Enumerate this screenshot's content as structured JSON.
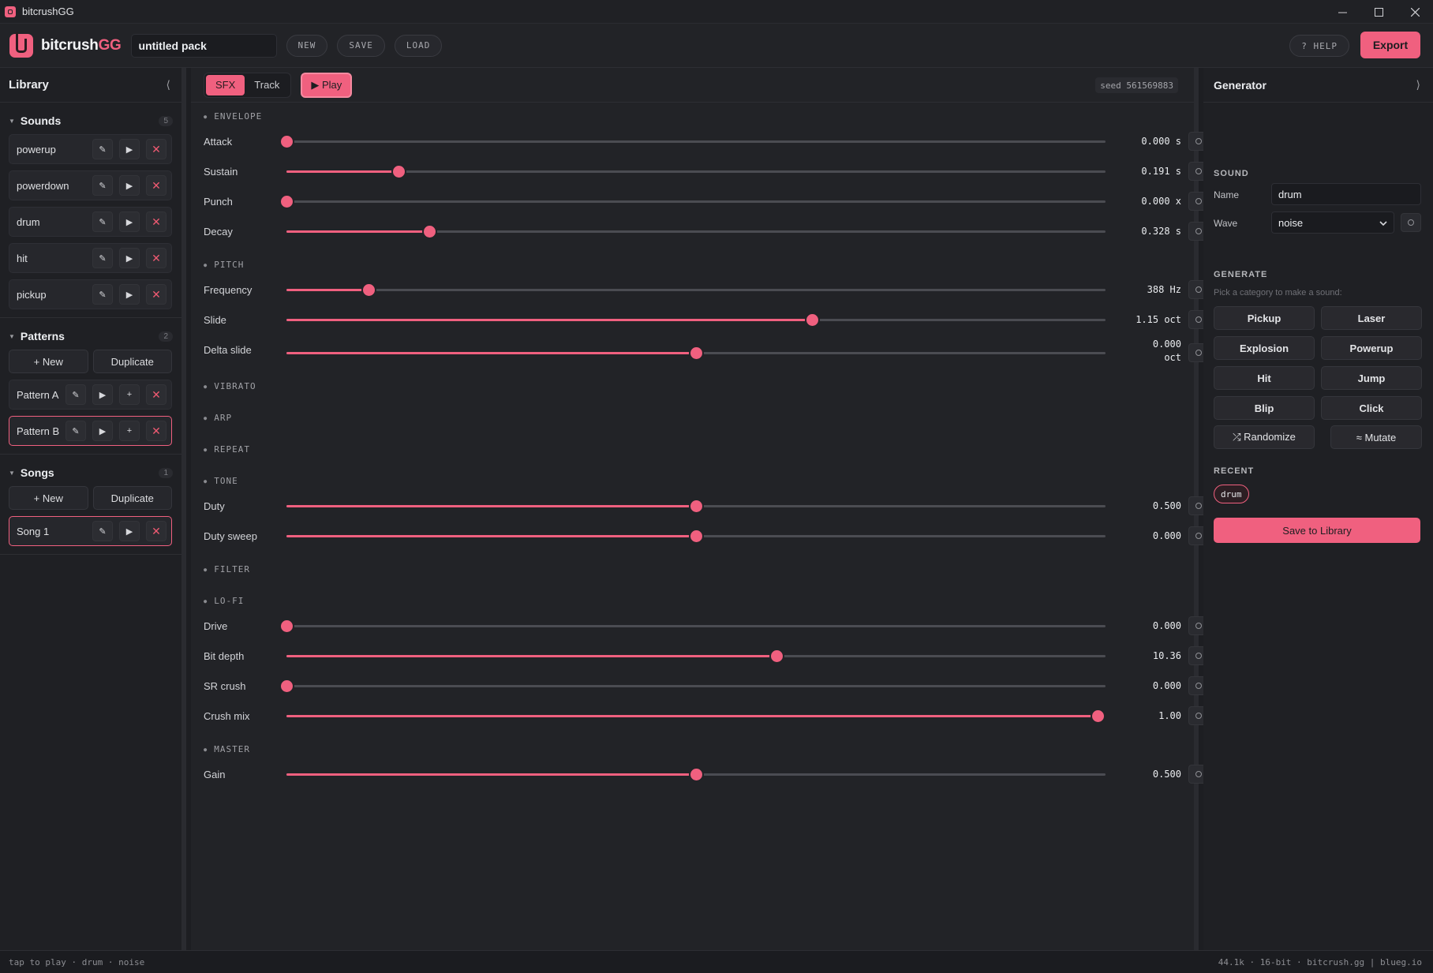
{
  "window": {
    "title": "bitcrushGG"
  },
  "header": {
    "logo_main": "bitcrush",
    "logo_accent": "GG",
    "pack_name": "untitled pack",
    "new_label": "NEW",
    "save_label": "SAVE",
    "load_label": "LOAD",
    "help_label": "? HELP",
    "export_label": "Export"
  },
  "library": {
    "title": "Library",
    "collapse_glyph": "⟨",
    "sounds": {
      "title": "Sounds",
      "count": "5",
      "items": [
        "powerup",
        "powerdown",
        "drum",
        "hit",
        "pickup"
      ]
    },
    "patterns": {
      "title": "Patterns",
      "count": "2",
      "new_label": "+ New",
      "duplicate_label": "Duplicate",
      "items": [
        "Pattern A",
        "Pattern B"
      ],
      "selected": "Pattern B"
    },
    "songs": {
      "title": "Songs",
      "count": "1",
      "new_label": "+ New",
      "duplicate_label": "Duplicate",
      "items": [
        "Song 1"
      ],
      "selected": "Song 1"
    }
  },
  "toolbar": {
    "tabs": [
      "SFX",
      "Track"
    ],
    "active_tab": "SFX",
    "play_label": "▶ Play",
    "seed": "seed 561569883"
  },
  "params": {
    "groups": [
      {
        "name": "ENVELOPE",
        "expanded": true,
        "rows": [
          {
            "label": "Attack",
            "value": "0.000 s",
            "level": 0.0
          },
          {
            "label": "Sustain",
            "value": "0.191 s",
            "level": 0.137
          },
          {
            "label": "Punch",
            "value": "0.000 x",
            "level": 0.0
          },
          {
            "label": "Decay",
            "value": "0.328 s",
            "level": 0.174
          }
        ]
      },
      {
        "name": "PITCH",
        "expanded": true,
        "rows": [
          {
            "label": "Frequency",
            "value": "388 Hz",
            "level": 0.1
          },
          {
            "label": "Slide",
            "value": "1.15 oct",
            "level": 0.642
          },
          {
            "label": "Delta slide",
            "value": "0.000\noct",
            "level": 0.5
          }
        ]
      },
      {
        "name": "VIBRATO",
        "expanded": false,
        "rows": []
      },
      {
        "name": "ARP",
        "expanded": false,
        "rows": []
      },
      {
        "name": "REPEAT",
        "expanded": false,
        "rows": []
      },
      {
        "name": "TONE",
        "expanded": true,
        "rows": [
          {
            "label": "Duty",
            "value": "0.500",
            "level": 0.5
          },
          {
            "label": "Duty sweep",
            "value": "0.000",
            "level": 0.5
          }
        ]
      },
      {
        "name": "FILTER",
        "expanded": false,
        "rows": []
      },
      {
        "name": "LO-FI",
        "expanded": true,
        "rows": [
          {
            "label": "Drive",
            "value": "0.000",
            "level": 0.0
          },
          {
            "label": "Bit depth",
            "value": "10.36",
            "level": 0.598
          },
          {
            "label": "SR crush",
            "value": "0.000",
            "level": 0.0
          },
          {
            "label": "Crush mix",
            "value": "1.00",
            "level": 0.99
          }
        ]
      },
      {
        "name": "MASTER",
        "expanded": true,
        "rows": [
          {
            "label": "Gain",
            "value": "0.500",
            "level": 0.5
          }
        ]
      }
    ]
  },
  "generator": {
    "title": "Generator",
    "expand_glyph": "⟩",
    "sound_section": "SOUND",
    "name_label": "Name",
    "name_value": "drum",
    "wave_label": "Wave",
    "wave_value": "noise",
    "generate_section": "GENERATE",
    "generate_hint": "Pick a category to make a sound:",
    "categories": [
      "Pickup",
      "Laser",
      "Explosion",
      "Powerup",
      "Hit",
      "Jump",
      "Blip",
      "Click"
    ],
    "randomize_label": "⤮ Randomize",
    "mutate_label": "≈ Mutate",
    "recent_section": "RECENT",
    "recent": [
      "drum"
    ],
    "save_label": "Save to Library"
  },
  "status": {
    "left": "tap to play · drum · noise",
    "right": "44.1k · 16-bit · bitcrush.gg | blueg.io"
  },
  "colors": {
    "accent": "#f0607f",
    "bg": "#222327",
    "panel": "#1f2024"
  }
}
